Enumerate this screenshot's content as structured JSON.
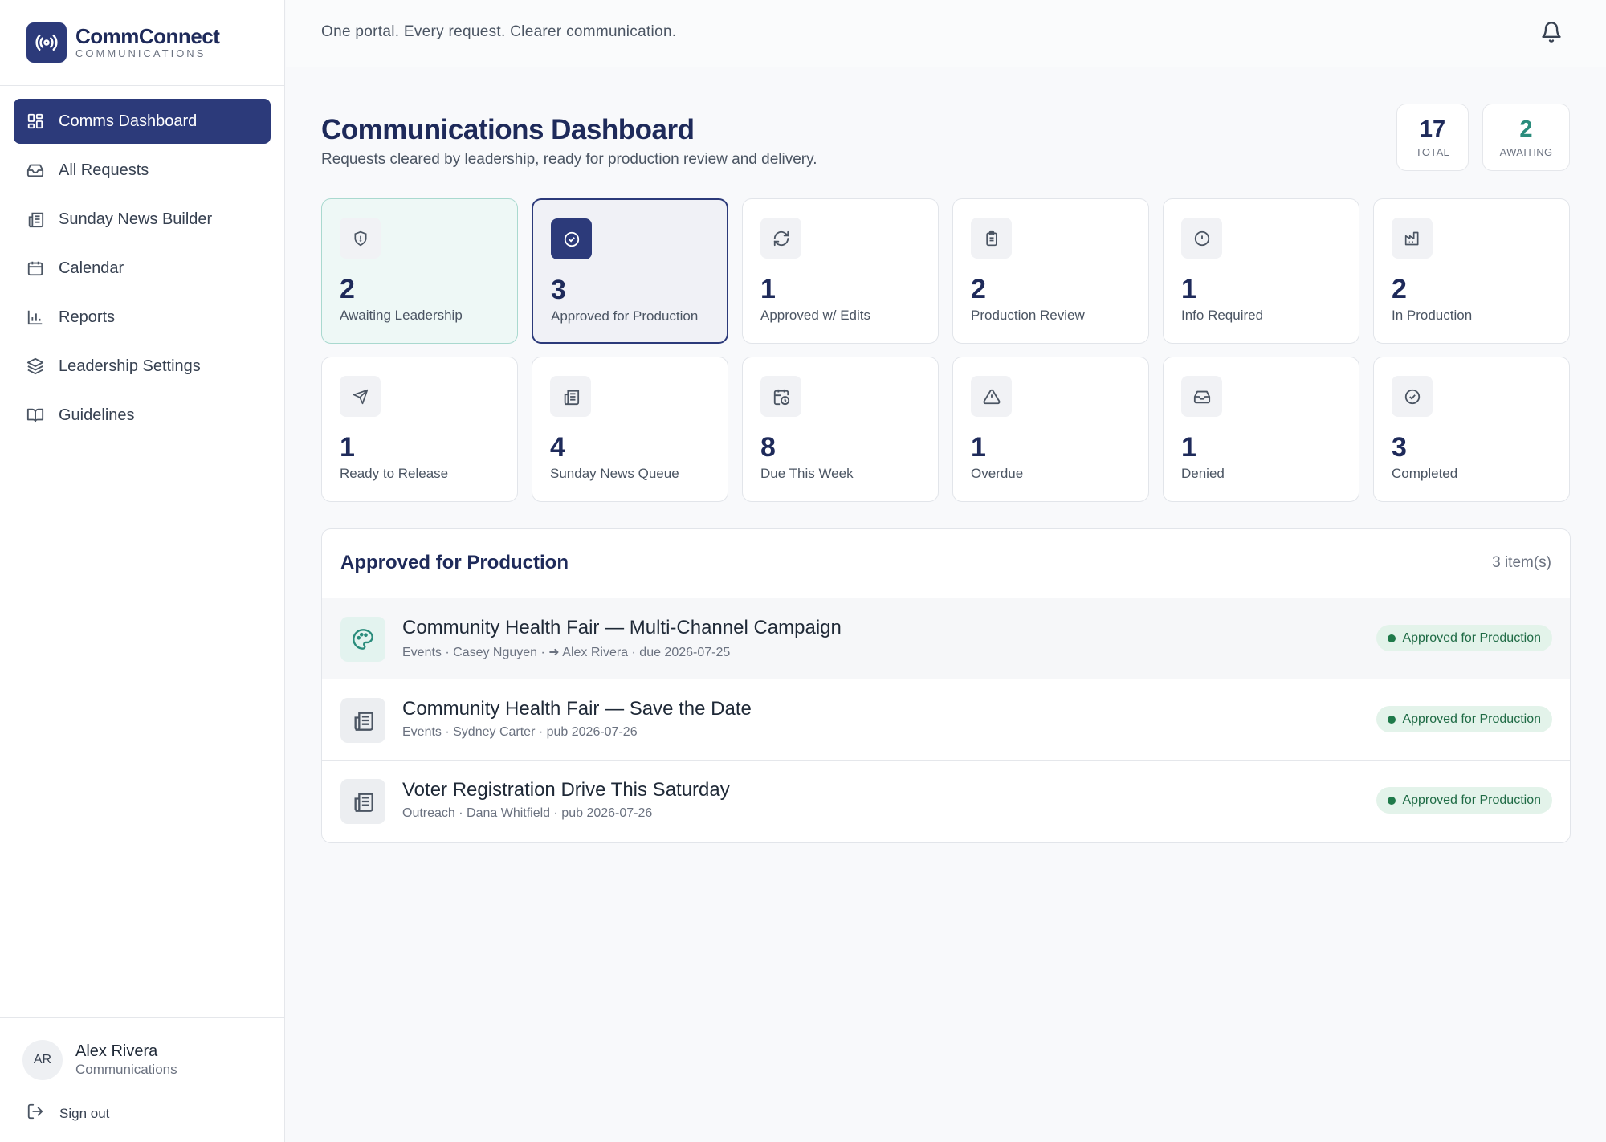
{
  "brand": {
    "name": "CommConnect",
    "subtitle": "COMMUNICATIONS"
  },
  "topbar": {
    "tagline": "One portal. Every request. Clearer communication."
  },
  "sidebar": {
    "items": [
      {
        "label": "Comms Dashboard",
        "icon": "dashboard-icon",
        "active": true
      },
      {
        "label": "All Requests",
        "icon": "inbox-icon"
      },
      {
        "label": "Sunday News Builder",
        "icon": "newspaper-icon"
      },
      {
        "label": "Calendar",
        "icon": "calendar-icon"
      },
      {
        "label": "Reports",
        "icon": "bar-chart-icon"
      },
      {
        "label": "Leadership Settings",
        "icon": "layers-icon"
      },
      {
        "label": "Guidelines",
        "icon": "book-icon"
      }
    ]
  },
  "user": {
    "initials": "AR",
    "name": "Alex Rivera",
    "role": "Communications",
    "signout": "Sign out"
  },
  "header": {
    "title": "Communications Dashboard",
    "subtitle": "Requests cleared by leadership, ready for production review and delivery.",
    "total": {
      "value": "17",
      "label": "TOTAL"
    },
    "awaiting": {
      "value": "2",
      "label": "AWAITING"
    }
  },
  "stats": [
    {
      "value": "2",
      "label": "Awaiting Leadership",
      "icon": "shield-icon"
    },
    {
      "value": "3",
      "label": "Approved for Production",
      "icon": "check-circle-icon"
    },
    {
      "value": "1",
      "label": "Approved w/ Edits",
      "icon": "refresh-icon"
    },
    {
      "value": "2",
      "label": "Production Review",
      "icon": "clipboard-icon"
    },
    {
      "value": "1",
      "label": "Info Required",
      "icon": "alert-circle-icon"
    },
    {
      "value": "2",
      "label": "In Production",
      "icon": "factory-icon"
    },
    {
      "value": "1",
      "label": "Ready to Release",
      "icon": "send-icon"
    },
    {
      "value": "4",
      "label": "Sunday News Queue",
      "icon": "newspaper-icon"
    },
    {
      "value": "8",
      "label": "Due This Week",
      "icon": "calendar-clock-icon"
    },
    {
      "value": "1",
      "label": "Overdue",
      "icon": "warning-triangle-icon"
    },
    {
      "value": "1",
      "label": "Denied",
      "icon": "inbox-icon"
    },
    {
      "value": "3",
      "label": "Completed",
      "icon": "check-circle-icon"
    }
  ],
  "panel": {
    "title": "Approved for Production",
    "count": "3 item(s)",
    "rows": [
      {
        "title": "Community Health Fair — Multi-Channel Campaign",
        "meta": "Events · Casey Nguyen · ➜ Alex Rivera · due 2026-07-25",
        "status": "Approved for Production",
        "icon": "palette-icon"
      },
      {
        "title": "Community Health Fair — Save the Date",
        "meta": "Events · Sydney Carter · pub 2026-07-26",
        "status": "Approved for Production",
        "icon": "newspaper-icon"
      },
      {
        "title": "Voter Registration Drive This Saturday",
        "meta": "Outreach · Dana Whitfield · pub 2026-07-26",
        "status": "Approved for Production",
        "icon": "newspaper-icon"
      }
    ]
  },
  "colors": {
    "primary": "#2c3a7a",
    "teal": "#2a8c7c",
    "success": "#1f7a4a"
  }
}
